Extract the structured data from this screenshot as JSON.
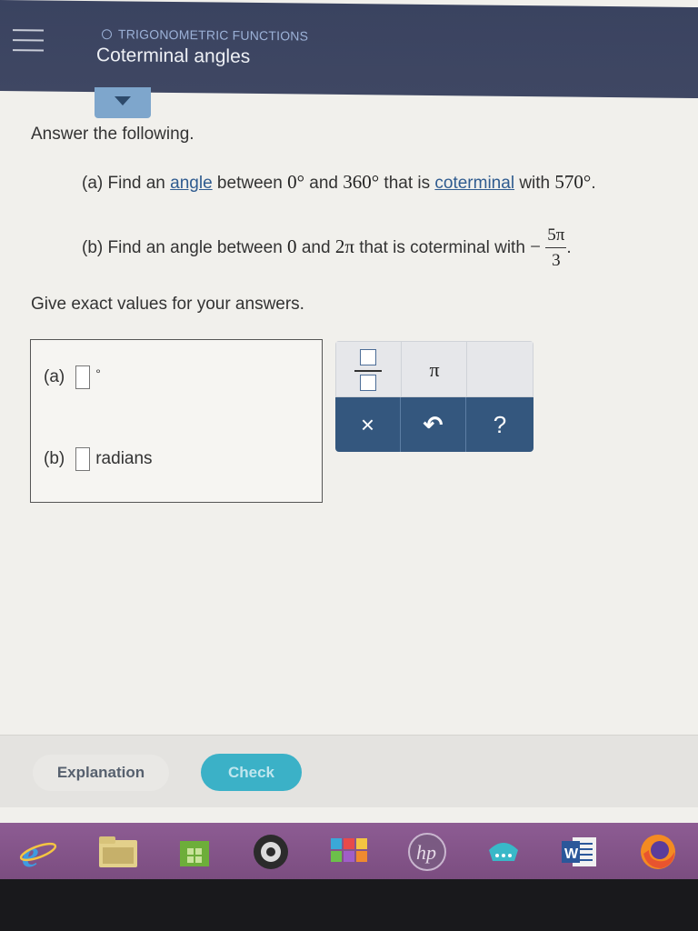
{
  "header": {
    "topic": "TRIGONOMETRIC FUNCTIONS",
    "title": "Coterminal angles"
  },
  "question": {
    "intro": "Answer the following.",
    "part_a": {
      "prefix": "(a) Find an ",
      "link1": "angle",
      "mid1": " between ",
      "v1": "0°",
      "mid2": " and ",
      "v2": "360°",
      "mid3": " that is ",
      "link2": "coterminal",
      "mid4": " with ",
      "v3": "570°",
      "end": "."
    },
    "part_b": {
      "prefix": "(b) Find an angle between ",
      "v1": "0",
      "mid1": " and ",
      "v2": "2π",
      "mid2": " that is coterminal with ",
      "neg": "−",
      "numerator": "5π",
      "denominator": "3",
      "end": "."
    },
    "instructions": "Give exact values for your answers."
  },
  "answers": {
    "a_label": "(a)",
    "a_unit": "°",
    "b_label": "(b)",
    "b_unit": "radians"
  },
  "keypad": {
    "pi_label": "π",
    "clear_label": "×",
    "undo_label": "↶",
    "help_label": "?"
  },
  "footer": {
    "explanation_label": "Explanation",
    "check_label": "Check"
  },
  "taskbar": {
    "word_label": "W"
  },
  "colors": {
    "header_bg": "#3f4763",
    "link": "#2f5b8f",
    "keypad_dark": "#34577e",
    "check_button": "#3bb1c7",
    "taskbar": "#8d5c93"
  }
}
